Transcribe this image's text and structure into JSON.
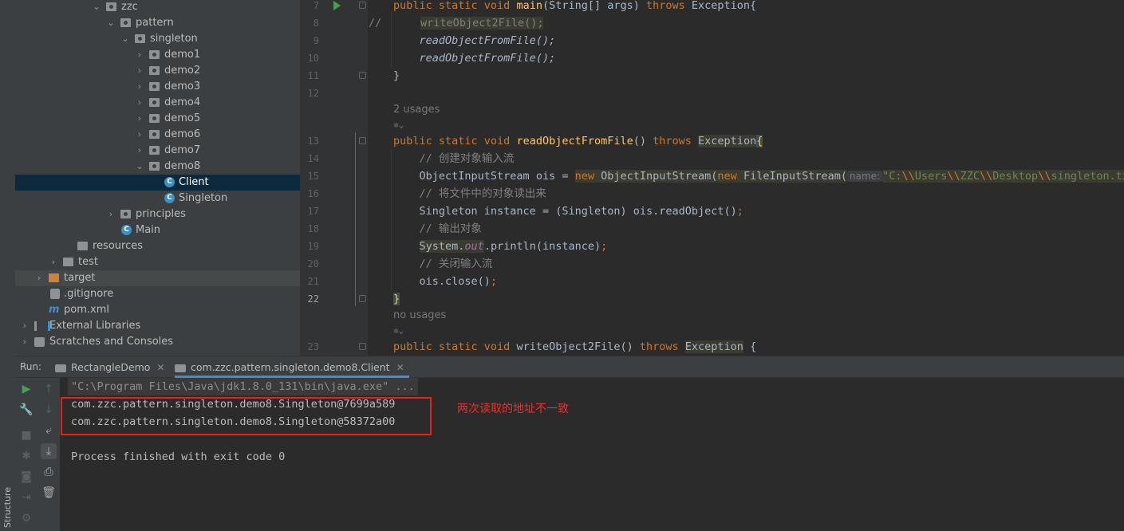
{
  "side_strip": {
    "structure_label": "Structure"
  },
  "project_tree": {
    "items": [
      {
        "label": "zzc"
      },
      {
        "label": "pattern"
      },
      {
        "label": "singleton"
      },
      {
        "label": "demo1"
      },
      {
        "label": "demo2"
      },
      {
        "label": "demo3"
      },
      {
        "label": "demo4"
      },
      {
        "label": "demo5"
      },
      {
        "label": "demo6"
      },
      {
        "label": "demo7"
      },
      {
        "label": "demo8"
      },
      {
        "label": "Client"
      },
      {
        "label": "Singleton"
      },
      {
        "label": "principles"
      },
      {
        "label": "Main"
      },
      {
        "label": "resources"
      },
      {
        "label": "test"
      },
      {
        "label": "target"
      },
      {
        "label": ".gitignore"
      },
      {
        "label": "pom.xml"
      },
      {
        "label": "External Libraries"
      },
      {
        "label": "Scratches and Consoles"
      }
    ]
  },
  "editor": {
    "line_numbers": [
      "7",
      "8",
      "9",
      "10",
      "11",
      "12",
      "13",
      "14",
      "15",
      "16",
      "17",
      "18",
      "19",
      "20",
      "21",
      "22",
      "23"
    ],
    "usages_1": "2 usages",
    "usages_2": "no usages",
    "code": {
      "l7_a": "public static void ",
      "l7_b": "main",
      "l7_c": "(String[] args) ",
      "l7_d": "throws ",
      "l7_e": "Exception{",
      "l8_a": "//",
      "l8_b": "writeObject2File();",
      "l9": "readObjectFromFile();",
      "l10": "readObjectFromFile();",
      "l11": "}",
      "l13_a": "public static void ",
      "l13_b": "readObjectFromFile",
      "l13_c": "() ",
      "l13_d": "throws ",
      "l13_e": "Exception",
      "l13_f": "{",
      "l14": "// 创建对象输入流",
      "l15_a": "ObjectInputStream ois = ",
      "l15_b": "new ",
      "l15_c": "ObjectInputStream(",
      "l15_d": "new ",
      "l15_e": "FileInputStream(",
      "l15_hint": "name:",
      "l15_str": "\"C:",
      "l15_s1": "\\\\",
      "l15_s2": "Users",
      "l15_s3": "\\\\",
      "l15_s4": "ZZC",
      "l15_s5": "\\\\",
      "l15_s6": "Desktop",
      "l15_s7": "\\\\",
      "l15_s8": "singleton.tx",
      "l16": "// 将文件中的对象读出来",
      "l17_a": "Singleton instance = (Singleton) ois.readObject()",
      "l17_b": ";",
      "l18": "// 输出对象",
      "l19_a": "System.",
      "l19_b": "out",
      "l19_c": ".println(instance)",
      "l19_d": ";",
      "l20": "// 关闭输入流",
      "l21_a": "ois.close()",
      "l21_b": ";",
      "l22": "}",
      "l23_a": "public static void ",
      "l23_b": "writeObject2File",
      "l23_c": "() ",
      "l23_d": "throws ",
      "l23_e": "Exception",
      "l23_f": " {"
    }
  },
  "run_panel": {
    "label": "Run:",
    "tabs": [
      {
        "label": "RectangleDemo"
      },
      {
        "label": "com.zzc.pattern.singleton.demo8.Client"
      }
    ],
    "console_lines": [
      "\"C:\\Program Files\\Java\\jdk1.8.0_131\\bin\\java.exe\" ...",
      "com.zzc.pattern.singleton.demo8.Singleton@7699a589",
      "com.zzc.pattern.singleton.demo8.Singleton@58372a00",
      "Process finished with exit code 0"
    ],
    "annotation": "两次读取的地址不一致"
  },
  "colors": {
    "annotation_red": "#e0241b",
    "selection": "#0d293e",
    "accent_tab": "#4a88c7"
  },
  "icons": [
    "chevron-right-icon",
    "chevron-down-icon",
    "folder-icon",
    "class-icon",
    "run-icon",
    "wrench-icon",
    "stop-icon",
    "soft-wrap-icon",
    "scroll-to-end-icon",
    "print-icon",
    "trash-icon"
  ]
}
